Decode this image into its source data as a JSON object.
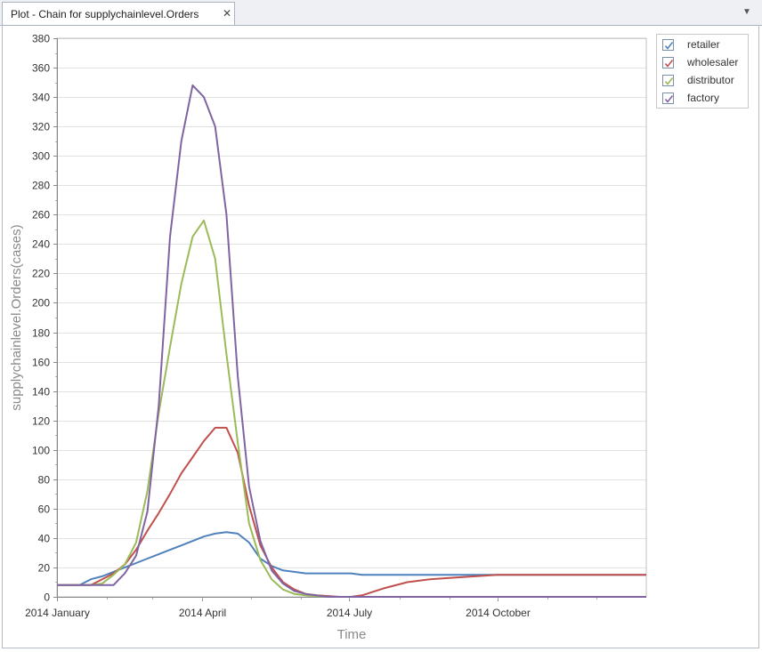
{
  "tab": {
    "title": "Plot - Chain for supplychainlevel.Orders",
    "close": "✕",
    "menu": "▼"
  },
  "colors": {
    "retailer": "#4f81bd",
    "wholesaler": "#c0504d",
    "distributor": "#9bbb59",
    "factory": "#8064a2"
  },
  "chart_data": {
    "type": "line",
    "xlabel": "Time",
    "ylabel": "supplychainlevel.Orders(cases)",
    "ylim": [
      0,
      380
    ],
    "yticks": [
      0,
      20,
      40,
      60,
      80,
      100,
      120,
      140,
      160,
      180,
      200,
      220,
      240,
      260,
      280,
      300,
      320,
      340,
      360,
      380
    ],
    "xlim": [
      "2014-01-01",
      "2015-01-01"
    ],
    "xticks": [
      {
        "date": "2014-01-01",
        "label": "2014 January"
      },
      {
        "date": "2014-04-01",
        "label": "2014 April"
      },
      {
        "date": "2014-07-01",
        "label": "2014 July"
      },
      {
        "date": "2014-10-01",
        "label": "2014 October"
      }
    ],
    "grid": true,
    "legend": "top-right",
    "series": [
      {
        "name": "retailer",
        "color": "#4f81bd",
        "points": [
          [
            "2014-01-01",
            8
          ],
          [
            "2014-01-08",
            8
          ],
          [
            "2014-01-15",
            8
          ],
          [
            "2014-01-22",
            12
          ],
          [
            "2014-01-29",
            14
          ],
          [
            "2014-02-05",
            17
          ],
          [
            "2014-02-12",
            20
          ],
          [
            "2014-02-19",
            23
          ],
          [
            "2014-02-26",
            26
          ],
          [
            "2014-03-05",
            29
          ],
          [
            "2014-03-12",
            32
          ],
          [
            "2014-03-19",
            35
          ],
          [
            "2014-03-26",
            38
          ],
          [
            "2014-04-02",
            41
          ],
          [
            "2014-04-09",
            43
          ],
          [
            "2014-04-16",
            44
          ],
          [
            "2014-04-23",
            43
          ],
          [
            "2014-04-30",
            37
          ],
          [
            "2014-05-07",
            26
          ],
          [
            "2014-05-14",
            21
          ],
          [
            "2014-05-21",
            18
          ],
          [
            "2014-05-28",
            17
          ],
          [
            "2014-06-04",
            16
          ],
          [
            "2014-06-18",
            16
          ],
          [
            "2014-07-02",
            16
          ],
          [
            "2014-07-09",
            15
          ],
          [
            "2014-08-01",
            15
          ],
          [
            "2014-09-01",
            15
          ],
          [
            "2014-10-01",
            15
          ],
          [
            "2014-11-01",
            15
          ],
          [
            "2014-12-01",
            15
          ],
          [
            "2015-01-01",
            15
          ]
        ]
      },
      {
        "name": "wholesaler",
        "color": "#c0504d",
        "points": [
          [
            "2014-01-01",
            8
          ],
          [
            "2014-01-08",
            8
          ],
          [
            "2014-01-15",
            8
          ],
          [
            "2014-01-22",
            8
          ],
          [
            "2014-01-29",
            12
          ],
          [
            "2014-02-05",
            16
          ],
          [
            "2014-02-12",
            22
          ],
          [
            "2014-02-19",
            32
          ],
          [
            "2014-02-26",
            45
          ],
          [
            "2014-03-05",
            57
          ],
          [
            "2014-03-12",
            70
          ],
          [
            "2014-03-19",
            84
          ],
          [
            "2014-03-26",
            95
          ],
          [
            "2014-04-02",
            106
          ],
          [
            "2014-04-09",
            115
          ],
          [
            "2014-04-16",
            115
          ],
          [
            "2014-04-23",
            98
          ],
          [
            "2014-04-30",
            62
          ],
          [
            "2014-05-07",
            35
          ],
          [
            "2014-05-14",
            20
          ],
          [
            "2014-05-21",
            10
          ],
          [
            "2014-05-28",
            5
          ],
          [
            "2014-06-04",
            2
          ],
          [
            "2014-06-11",
            1
          ],
          [
            "2014-06-25",
            0
          ],
          [
            "2014-07-02",
            0
          ],
          [
            "2014-07-09",
            1
          ],
          [
            "2014-07-23",
            6
          ],
          [
            "2014-08-06",
            10
          ],
          [
            "2014-08-20",
            12
          ],
          [
            "2014-09-03",
            13
          ],
          [
            "2014-09-17",
            14
          ],
          [
            "2014-10-01",
            15
          ],
          [
            "2014-11-01",
            15
          ],
          [
            "2014-12-01",
            15
          ],
          [
            "2015-01-01",
            15
          ]
        ]
      },
      {
        "name": "distributor",
        "color": "#9bbb59",
        "points": [
          [
            "2014-01-01",
            8
          ],
          [
            "2014-01-08",
            8
          ],
          [
            "2014-01-15",
            8
          ],
          [
            "2014-01-22",
            8
          ],
          [
            "2014-01-29",
            9
          ],
          [
            "2014-02-05",
            15
          ],
          [
            "2014-02-12",
            22
          ],
          [
            "2014-02-19",
            37
          ],
          [
            "2014-02-26",
            72
          ],
          [
            "2014-03-05",
            125
          ],
          [
            "2014-03-12",
            170
          ],
          [
            "2014-03-19",
            213
          ],
          [
            "2014-03-26",
            245
          ],
          [
            "2014-04-02",
            256
          ],
          [
            "2014-04-09",
            230
          ],
          [
            "2014-04-16",
            165
          ],
          [
            "2014-04-23",
            105
          ],
          [
            "2014-04-30",
            50
          ],
          [
            "2014-05-07",
            25
          ],
          [
            "2014-05-14",
            12
          ],
          [
            "2014-05-21",
            5
          ],
          [
            "2014-05-28",
            2
          ],
          [
            "2014-06-04",
            1
          ],
          [
            "2014-06-18",
            0
          ],
          [
            "2014-07-02",
            0
          ],
          [
            "2014-08-01",
            0
          ],
          [
            "2014-10-01",
            0
          ],
          [
            "2015-01-01",
            0
          ]
        ]
      },
      {
        "name": "factory",
        "color": "#8064a2",
        "points": [
          [
            "2014-01-01",
            8
          ],
          [
            "2014-01-08",
            8
          ],
          [
            "2014-01-15",
            8
          ],
          [
            "2014-01-22",
            8
          ],
          [
            "2014-01-29",
            8
          ],
          [
            "2014-02-05",
            8
          ],
          [
            "2014-02-12",
            16
          ],
          [
            "2014-02-19",
            28
          ],
          [
            "2014-02-26",
            58
          ],
          [
            "2014-03-05",
            130
          ],
          [
            "2014-03-12",
            245
          ],
          [
            "2014-03-19",
            310
          ],
          [
            "2014-03-26",
            348
          ],
          [
            "2014-04-02",
            340
          ],
          [
            "2014-04-09",
            320
          ],
          [
            "2014-04-16",
            260
          ],
          [
            "2014-04-23",
            150
          ],
          [
            "2014-04-30",
            75
          ],
          [
            "2014-05-07",
            38
          ],
          [
            "2014-05-14",
            18
          ],
          [
            "2014-05-21",
            9
          ],
          [
            "2014-05-28",
            4
          ],
          [
            "2014-06-04",
            2
          ],
          [
            "2014-06-18",
            0
          ],
          [
            "2014-07-02",
            0
          ],
          [
            "2014-08-01",
            0
          ],
          [
            "2014-10-01",
            0
          ],
          [
            "2015-01-01",
            0
          ]
        ]
      }
    ]
  }
}
